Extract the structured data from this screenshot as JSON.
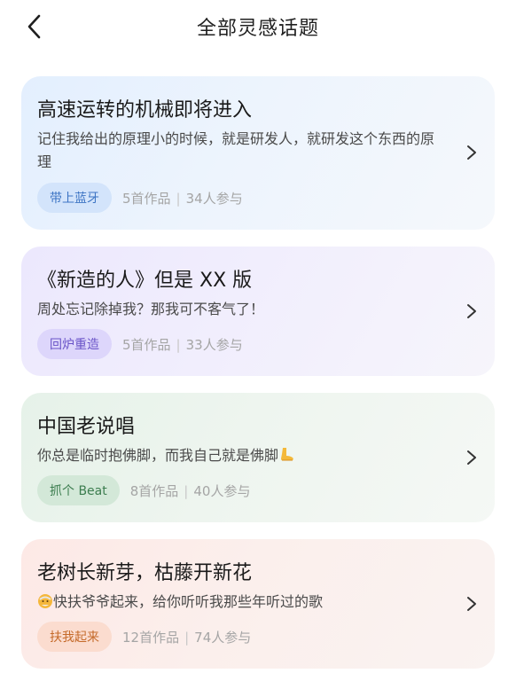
{
  "header": {
    "title": "全部灵感话题"
  },
  "topics": [
    {
      "title": "高速运转的机械即将进入",
      "description": "记住我给出的原理小的时候，就是研发人，就研发这个东西的原理",
      "tag": "带上蓝牙",
      "works": "5首作品",
      "participants": "34人参与",
      "theme": "blue"
    },
    {
      "title": "《新造的人》但是 XX 版",
      "description": "周处忘记除掉我？那我可不客气了！",
      "tag": "回炉重造",
      "works": "5首作品",
      "participants": "33人参与",
      "theme": "purple"
    },
    {
      "title": "中国老说唱",
      "description": "你总是临时抱佛脚，而我自己就是佛脚",
      "description_emoji": "foot-emoji",
      "tag": "抓个 Beat",
      "works": "8首作品",
      "participants": "40人参与",
      "theme": "green"
    },
    {
      "title": "老树长新芽，枯藤开新花",
      "description": "快扶爷爷起来，给你听听我那些年听过的歌",
      "description_emoji": "old-man-emoji",
      "tag": "扶我起来",
      "works": "12首作品",
      "participants": "74人参与",
      "theme": "orange"
    }
  ],
  "separator": "|"
}
